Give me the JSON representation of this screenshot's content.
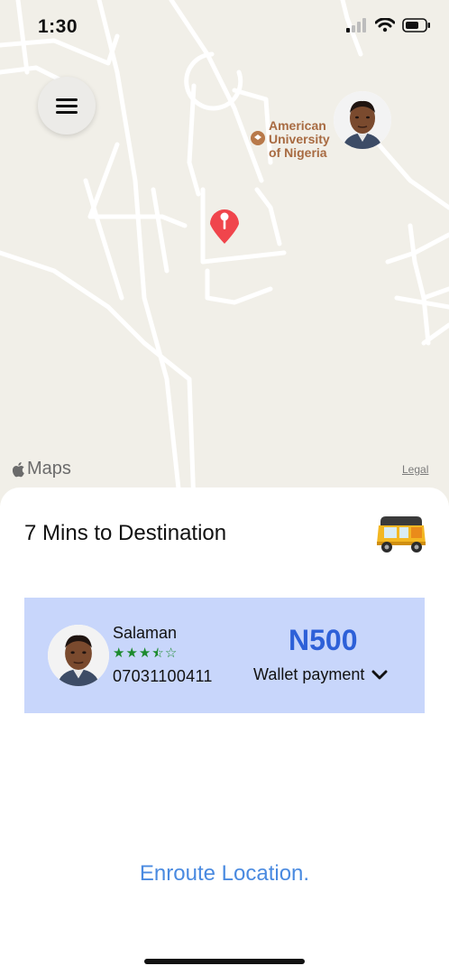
{
  "status_bar": {
    "time": "1:30"
  },
  "map": {
    "poi_label": "American University of Nigeria",
    "attribution": "Maps",
    "legal_label": "Legal",
    "pin_color": "#f0454c"
  },
  "trip": {
    "eta_text": "7 Mins to Destination",
    "vehicle_icon": "tuktuk-icon"
  },
  "driver": {
    "name": "Salaman",
    "rating": 3.5,
    "rating_max": 5,
    "phone": "07031100411"
  },
  "payment": {
    "fare": "N500",
    "method": "Wallet payment"
  },
  "footer": {
    "enroute_label": "Enroute Location."
  },
  "colors": {
    "card_bg": "#c8d6fb",
    "fare": "#2d60d8",
    "link": "#4a8ae0",
    "stars": "#1c8a2d",
    "map_bg": "#f1efe8"
  }
}
